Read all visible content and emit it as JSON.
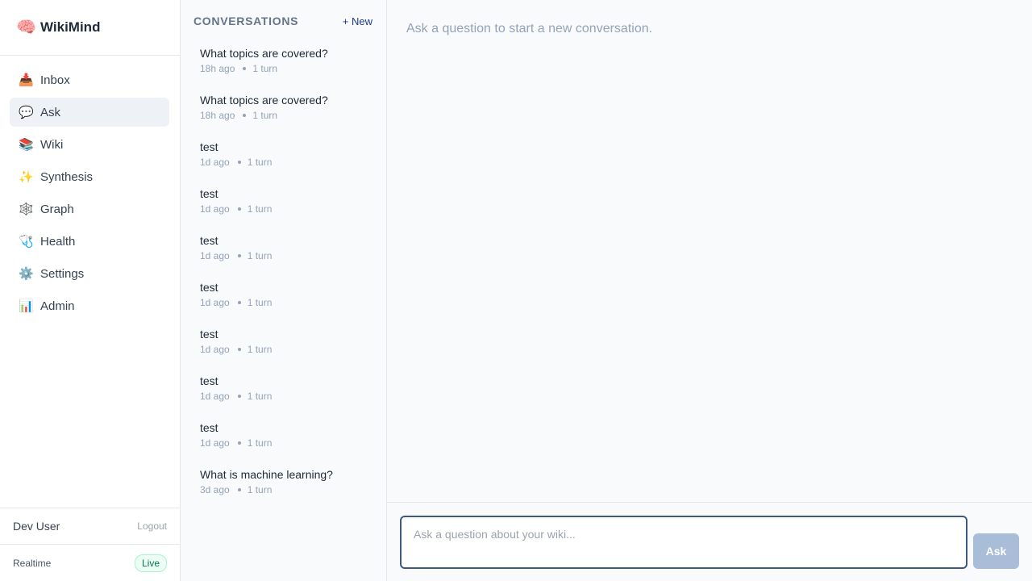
{
  "brand": {
    "icon": "brain-emoji",
    "glyph": "🧠",
    "name": "WikiMind"
  },
  "nav": [
    {
      "label": "Inbox",
      "icon": "inbox-tray-icon",
      "glyph": "📥",
      "active": false
    },
    {
      "label": "Ask",
      "icon": "speech-bubble-icon",
      "glyph": "💬",
      "active": true
    },
    {
      "label": "Wiki",
      "icon": "books-icon",
      "glyph": "📚",
      "active": false
    },
    {
      "label": "Synthesis",
      "icon": "sparkles-icon",
      "glyph": "✨",
      "active": false
    },
    {
      "label": "Graph",
      "icon": "web-icon",
      "glyph": "🕸️",
      "active": false
    },
    {
      "label": "Health",
      "icon": "stethoscope-icon",
      "glyph": "🩺",
      "active": false
    },
    {
      "label": "Settings",
      "icon": "gear-icon",
      "glyph": "⚙️",
      "active": false
    },
    {
      "label": "Admin",
      "icon": "bar-chart-icon",
      "glyph": "📊",
      "active": false
    }
  ],
  "user": {
    "name": "Dev User",
    "logout_label": "Logout"
  },
  "realtime": {
    "label": "Realtime",
    "status": "Live"
  },
  "conversations": {
    "title": "CONVERSATIONS",
    "new_label": "+ New",
    "items": [
      {
        "question": "What topics are covered?",
        "age": "18h ago",
        "turns": "1 turn"
      },
      {
        "question": "What topics are covered?",
        "age": "18h ago",
        "turns": "1 turn"
      },
      {
        "question": "test",
        "age": "1d ago",
        "turns": "1 turn"
      },
      {
        "question": "test",
        "age": "1d ago",
        "turns": "1 turn"
      },
      {
        "question": "test",
        "age": "1d ago",
        "turns": "1 turn"
      },
      {
        "question": "test",
        "age": "1d ago",
        "turns": "1 turn"
      },
      {
        "question": "test",
        "age": "1d ago",
        "turns": "1 turn"
      },
      {
        "question": "test",
        "age": "1d ago",
        "turns": "1 turn"
      },
      {
        "question": "test",
        "age": "1d ago",
        "turns": "1 turn"
      },
      {
        "question": "What is machine learning?",
        "age": "3d ago",
        "turns": "1 turn"
      }
    ]
  },
  "main": {
    "empty_hint": "Ask a question to start a new conversation.",
    "input_placeholder": "Ask a question about your wiki...",
    "input_value": "",
    "ask_label": "Ask"
  },
  "colors": {
    "accent": "#1e3a8a",
    "input_border": "#3d5a80",
    "ask_button_disabled": "#a9bdd8",
    "active_nav_bg": "#eef2f7",
    "live_green": "#047857"
  }
}
